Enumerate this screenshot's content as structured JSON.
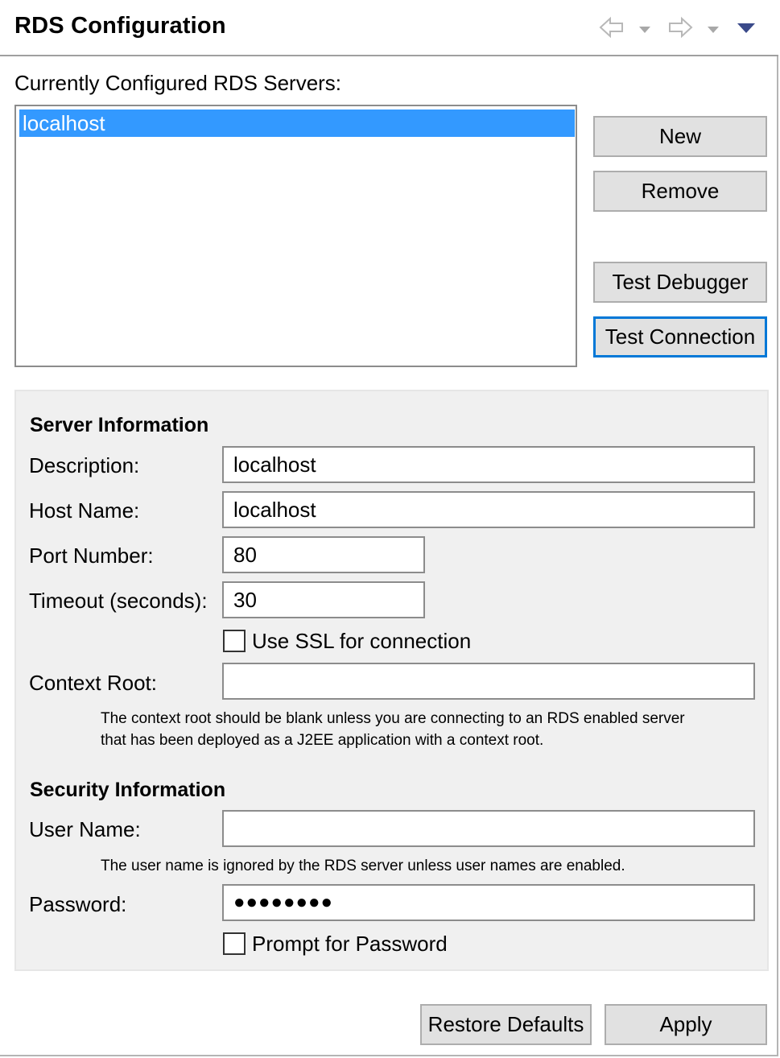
{
  "header": {
    "title": "RDS Configuration",
    "icons": [
      "back-arrow-icon",
      "back-dropdown-icon",
      "forward-arrow-icon",
      "forward-dropdown-icon",
      "view-menu-icon"
    ]
  },
  "servers": {
    "label": "Currently Configured RDS Servers:",
    "items": [
      "localhost"
    ],
    "selected": "localhost"
  },
  "actions": {
    "new": "New",
    "remove": "Remove",
    "test_debugger": "Test Debugger",
    "test_connection": "Test Connection"
  },
  "server_info": {
    "heading": "Server Information",
    "description_label": "Description:",
    "description_value": "localhost",
    "host_label": "Host Name:",
    "host_value": "localhost",
    "port_label": "Port Number:",
    "port_value": "80",
    "timeout_label": "Timeout (seconds):",
    "timeout_value": "30",
    "ssl_label": "Use SSL for connection",
    "ssl_checked": false,
    "context_label": "Context Root:",
    "context_value": "",
    "context_note_line1": "The context root should be blank unless you are connecting to an RDS enabled server",
    "context_note_line2": "that has been deployed as a J2EE application with a context root."
  },
  "security_info": {
    "heading": "Security Information",
    "user_label": "User Name:",
    "user_value": "",
    "user_note": "The user name is ignored by the RDS server unless user names are enabled.",
    "password_label": "Password:",
    "password_mask": "●●●●●●●●",
    "prompt_label": "Prompt for Password",
    "prompt_checked": false
  },
  "footer": {
    "restore": "Restore Defaults",
    "apply": "Apply"
  },
  "colors": {
    "selection": "#3399ff",
    "focus_border": "#0078d7",
    "button_bg": "#e1e1e1",
    "group_bg": "#f0f0f0"
  }
}
